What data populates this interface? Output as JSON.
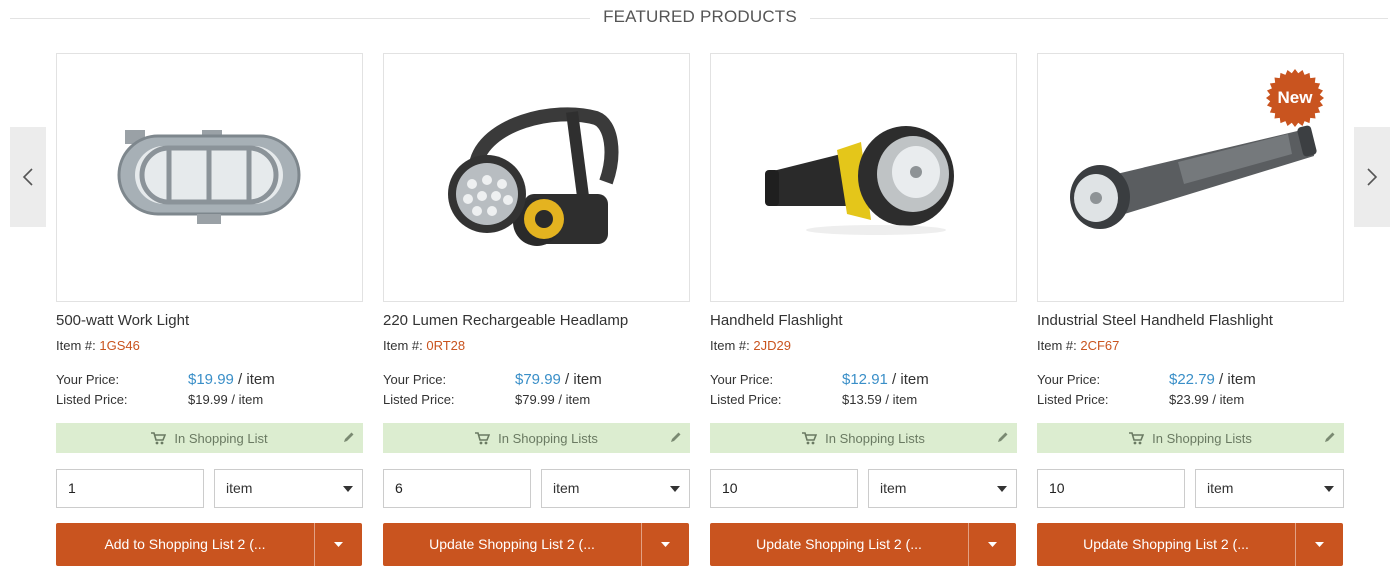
{
  "section": {
    "title": "FEATURED PRODUCTS"
  },
  "carousel": {
    "prev_icon": "chevron-left",
    "next_icon": "chevron-right"
  },
  "labels": {
    "item_prefix": "Item #: ",
    "your_price": "Your Price:",
    "listed_price": "Listed Price:",
    "per_item": " / item"
  },
  "products": [
    {
      "name": "500-watt Work Light",
      "item_number": "1GS46",
      "your_price": "$19.99",
      "listed_price": "$19.99 / item",
      "list_status": "In Shopping List",
      "quantity": "1",
      "unit": "item",
      "action_label": "Add to Shopping List 2 (...",
      "badge": ""
    },
    {
      "name": "220 Lumen Rechargeable Headlamp",
      "item_number": "0RT28",
      "your_price": "$79.99",
      "listed_price": "$79.99 / item",
      "list_status": "In Shopping Lists",
      "quantity": "6",
      "unit": "item",
      "action_label": "Update Shopping List 2 (...",
      "badge": ""
    },
    {
      "name": "Handheld Flashlight",
      "item_number": "2JD29",
      "your_price": "$12.91",
      "listed_price": "$13.59 / item",
      "list_status": "In Shopping Lists",
      "quantity": "10",
      "unit": "item",
      "action_label": "Update Shopping List 2 (...",
      "badge": ""
    },
    {
      "name": "Industrial Steel Handheld Flashlight",
      "item_number": "2CF67",
      "your_price": "$22.79",
      "listed_price": "$23.99 / item",
      "list_status": "In Shopping Lists",
      "quantity": "10",
      "unit": "item",
      "action_label": "Update Shopping List 2 (...",
      "badge": "New"
    }
  ],
  "colors": {
    "accent": "#c9541f",
    "price_blue": "#3a8fc8",
    "list_green_bg": "#dcedd0",
    "nav_bg": "#ececec"
  }
}
